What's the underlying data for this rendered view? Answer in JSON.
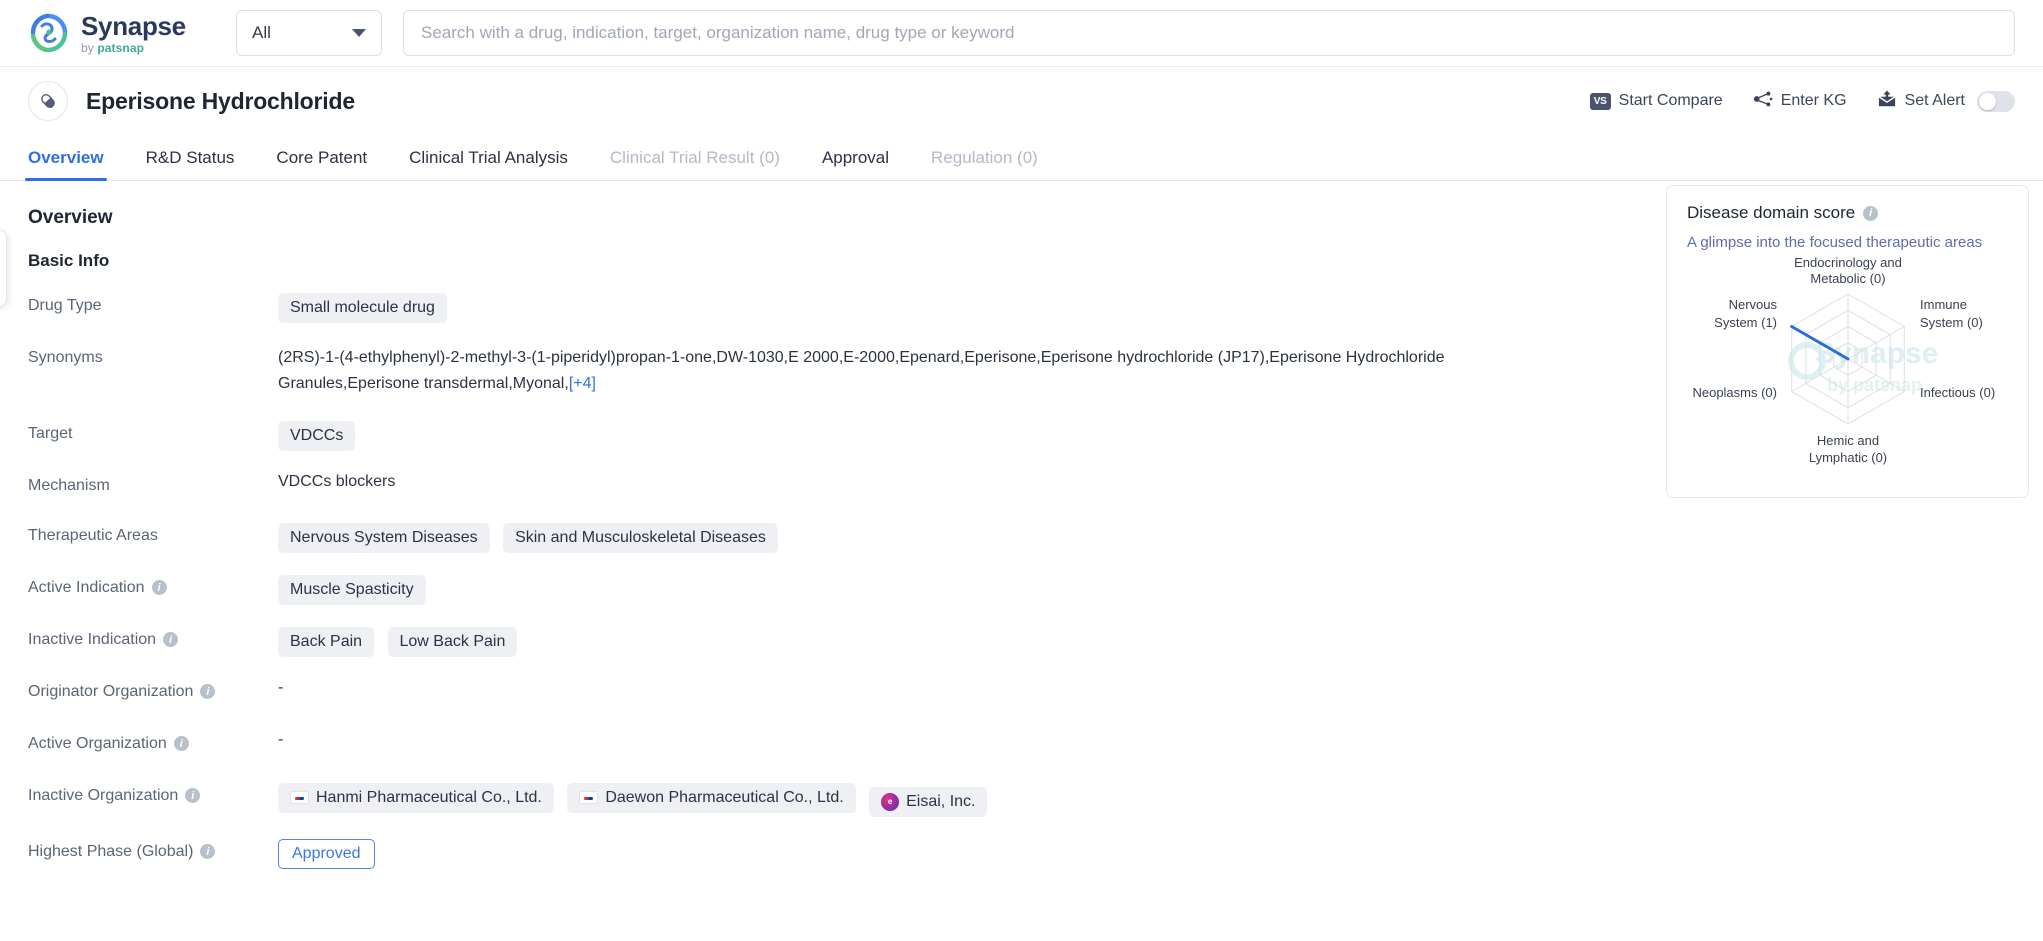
{
  "brand": {
    "name": "Synapse",
    "by": "by",
    "sub": "patsnap"
  },
  "search": {
    "scope_value": "All",
    "placeholder": "Search with a drug, indication, target, organization name, drug type or keyword",
    "value": ""
  },
  "drug_header": {
    "title": "Eperisone Hydrochloride",
    "actions": {
      "start_compare": "Start Compare",
      "vs_badge": "VS",
      "enter_kg": "Enter KG",
      "set_alert": "Set Alert"
    }
  },
  "tabs": [
    {
      "label": "Overview",
      "active": true,
      "disabled": false
    },
    {
      "label": "R&D Status",
      "active": false,
      "disabled": false
    },
    {
      "label": "Core Patent",
      "active": false,
      "disabled": false
    },
    {
      "label": "Clinical Trial Analysis",
      "active": false,
      "disabled": false
    },
    {
      "label": "Clinical Trial Result (0)",
      "active": false,
      "disabled": true
    },
    {
      "label": "Approval",
      "active": false,
      "disabled": false
    },
    {
      "label": "Regulation (0)",
      "active": false,
      "disabled": true
    }
  ],
  "overview": {
    "section_title": "Overview",
    "basic_info_title": "Basic Info",
    "labels": {
      "drug_type": "Drug Type",
      "synonyms": "Synonyms",
      "target": "Target",
      "mechanism": "Mechanism",
      "therapeutic_areas": "Therapeutic Areas",
      "active_indication": "Active Indication",
      "inactive_indication": "Inactive Indication",
      "originator_organization": "Originator Organization",
      "active_organization": "Active Organization",
      "inactive_organization": "Inactive Organization",
      "highest_phase": "Highest Phase (Global)"
    },
    "drug_type": "Small molecule drug",
    "synonyms_text": "(2RS)-1-(4-ethylphenyl)-2-methyl-3-(1-piperidyl)propan-1-one,DW-1030,E 2000,E-2000,Epenard,Eperisone,Eperisone hydrochloride (JP17),Eperisone Hydrochloride Granules,Eperisone transdermal,Myonal,",
    "synonyms_more": "[+4]",
    "target": "VDCCs",
    "mechanism": "VDCCs blockers",
    "therapeutic_areas": [
      "Nervous System Diseases",
      "Skin and Musculoskeletal Diseases"
    ],
    "active_indications": [
      "Muscle Spasticity"
    ],
    "inactive_indications": [
      "Back Pain",
      "Low Back Pain"
    ],
    "originator_organization": "-",
    "active_organization": "-",
    "inactive_organizations": [
      {
        "name": "Hanmi Pharmaceutical Co., Ltd.",
        "icon": "flag-kr-icon"
      },
      {
        "name": "Daewon Pharmaceutical Co., Ltd.",
        "icon": "flag-kr-icon"
      },
      {
        "name": "Eisai, Inc.",
        "icon": "eisai-logo-icon"
      }
    ],
    "highest_phase": "Approved"
  },
  "score_card": {
    "title": "Disease domain score",
    "subtitle": "A glimpse into the focused therapeutic areas",
    "watermark_top": "Synapse",
    "watermark_bottom": "by patsnap"
  },
  "chart_data": {
    "type": "radar",
    "title": "Disease domain score",
    "categories": [
      "Endocrinology and Metabolic (0)",
      "Immune System (0)",
      "Infectious (0)",
      "Hemic and Lymphatic (0)",
      "Neoplasms (0)",
      "Nervous System (1)"
    ],
    "axis_labels": [
      {
        "line1": "Endocrinology and",
        "line2": "Metabolic (0)",
        "value": 0
      },
      {
        "line1": "Immune",
        "line2": "System (0)",
        "value": 0
      },
      {
        "line1": "Infectious (0)",
        "line2": "",
        "value": 0
      },
      {
        "line1": "Hemic and",
        "line2": "Lymphatic (0)",
        "value": 0
      },
      {
        "line1": "Neoplasms (0)",
        "line2": "",
        "value": 0
      },
      {
        "line1": "Nervous",
        "line2": "System (1)",
        "value": 1
      }
    ],
    "values": [
      0,
      0,
      0,
      0,
      0,
      1
    ],
    "rlim": [
      0,
      1
    ],
    "rings": 4,
    "grid": true,
    "legend": "none",
    "series_color": "#2a6fd4"
  },
  "colors": {
    "accent": "#2f6fe4",
    "tag_bg": "#eef0f4",
    "text": "#2b3242",
    "muted": "#5c6478",
    "brand_teal": "#3fa89b"
  }
}
